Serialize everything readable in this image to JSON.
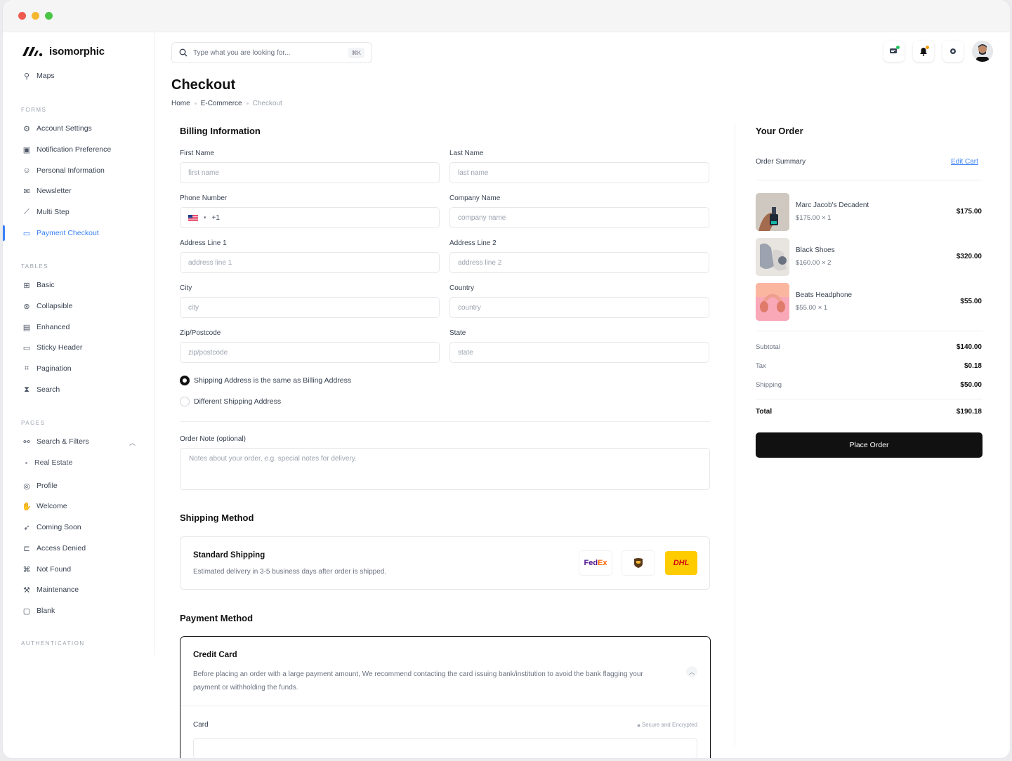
{
  "window": {
    "dots": [
      "#f05a4f",
      "#f5b72f",
      "#4bc545"
    ]
  },
  "brand": {
    "name": "isomorphic"
  },
  "sidebar": {
    "maps": "Maps",
    "sections": {
      "forms": "FORMS",
      "tables": "TABLES",
      "pages": "PAGES",
      "auth": "AUTHENTICATION"
    },
    "forms": [
      {
        "label": "Account Settings",
        "icon": "user-gear-icon"
      },
      {
        "label": "Notification Preference",
        "icon": "bell-settings-icon"
      },
      {
        "label": "Personal Information",
        "icon": "user-icon"
      },
      {
        "label": "Newsletter",
        "icon": "mail-icon"
      },
      {
        "label": "Multi Step",
        "icon": "steps-icon"
      },
      {
        "label": "Payment Checkout",
        "icon": "credit-card-icon"
      }
    ],
    "tables": [
      {
        "label": "Basic",
        "icon": "grid-icon"
      },
      {
        "label": "Collapsible",
        "icon": "collapse-icon"
      },
      {
        "label": "Enhanced",
        "icon": "table-icon"
      },
      {
        "label": "Sticky Header",
        "icon": "window-icon"
      },
      {
        "label": "Pagination",
        "icon": "pagination-icon"
      },
      {
        "label": "Search",
        "icon": "hourglass-icon"
      }
    ],
    "pages": [
      {
        "label": "Search & Filters",
        "icon": "filter-icon"
      },
      {
        "label": "Profile",
        "icon": "globe-icon"
      },
      {
        "label": "Welcome",
        "icon": "wave-icon"
      },
      {
        "label": "Coming Soon",
        "icon": "rocket-icon"
      },
      {
        "label": "Access Denied",
        "icon": "folder-lock-icon"
      },
      {
        "label": "Not Found",
        "icon": "not-found-icon"
      },
      {
        "label": "Maintenance",
        "icon": "wrench-icon"
      },
      {
        "label": "Blank",
        "icon": "blank-page-icon"
      }
    ],
    "pages_sub": "Real Estate"
  },
  "search": {
    "placeholder": "Type what you are looking for...",
    "shortcut": "⌘K"
  },
  "header": {
    "title": "Checkout",
    "breadcrumb": [
      "Home",
      "E-Commerce",
      "Checkout"
    ]
  },
  "billing": {
    "title": "Billing Information",
    "fields": {
      "first_name": {
        "label": "First Name",
        "placeholder": "first name"
      },
      "last_name": {
        "label": "Last Name",
        "placeholder": "last name"
      },
      "phone": {
        "label": "Phone Number",
        "value": "+1"
      },
      "company": {
        "label": "Company Name",
        "placeholder": "company name"
      },
      "address1": {
        "label": "Address Line 1",
        "placeholder": "address line 1"
      },
      "address2": {
        "label": "Address Line 2",
        "placeholder": "address line 2"
      },
      "city": {
        "label": "City",
        "placeholder": "city"
      },
      "country": {
        "label": "Country",
        "placeholder": "country"
      },
      "zip": {
        "label": "Zip/Postcode",
        "placeholder": "zip/postcode"
      },
      "state": {
        "label": "State",
        "placeholder": "state"
      }
    },
    "same_address": "Shipping Address is the same as Billing Address",
    "different_address": "Different Shipping Address",
    "note_label": "Order Note (optional)",
    "note_placeholder": "Notes about your order, e.g. special notes for delivery."
  },
  "shipping": {
    "title": "Shipping Method",
    "option_title": "Standard Shipping",
    "option_desc": "Estimated delivery in 3-5 business days after order is shipped.",
    "carriers": [
      "FedEx",
      "UPS",
      "DHL"
    ]
  },
  "payment": {
    "title": "Payment Method",
    "option_title": "Credit Card",
    "option_desc": "Before placing an order with a large payment amount, We recommend contacting the card issuing bank/institution to avoid the bank flagging your payment or withholding the funds.",
    "card_label": "Card",
    "secure": "Secure and Encrypted"
  },
  "order": {
    "title": "Your Order",
    "summary": "Order Summary",
    "edit_cart": "Edit Cart",
    "items": [
      {
        "name": "Marc Jacob's Decadent",
        "meta": "$175.00 × 1",
        "price": "$175.00"
      },
      {
        "name": "Black Shoes",
        "meta": "$160.00 × 2",
        "price": "$320.00"
      },
      {
        "name": "Beats Headphone",
        "meta": "$55.00 × 1",
        "price": "$55.00"
      }
    ],
    "subtotal_label": "Subtotal",
    "subtotal": "$140.00",
    "tax_label": "Tax",
    "tax": "$0.18",
    "shipping_label": "Shipping",
    "shipping": "$50.00",
    "total_label": "Total",
    "total": "$190.18",
    "place_order": "Place Order"
  },
  "colors": {
    "accent": "#3b82f6",
    "primary": "#111111"
  }
}
